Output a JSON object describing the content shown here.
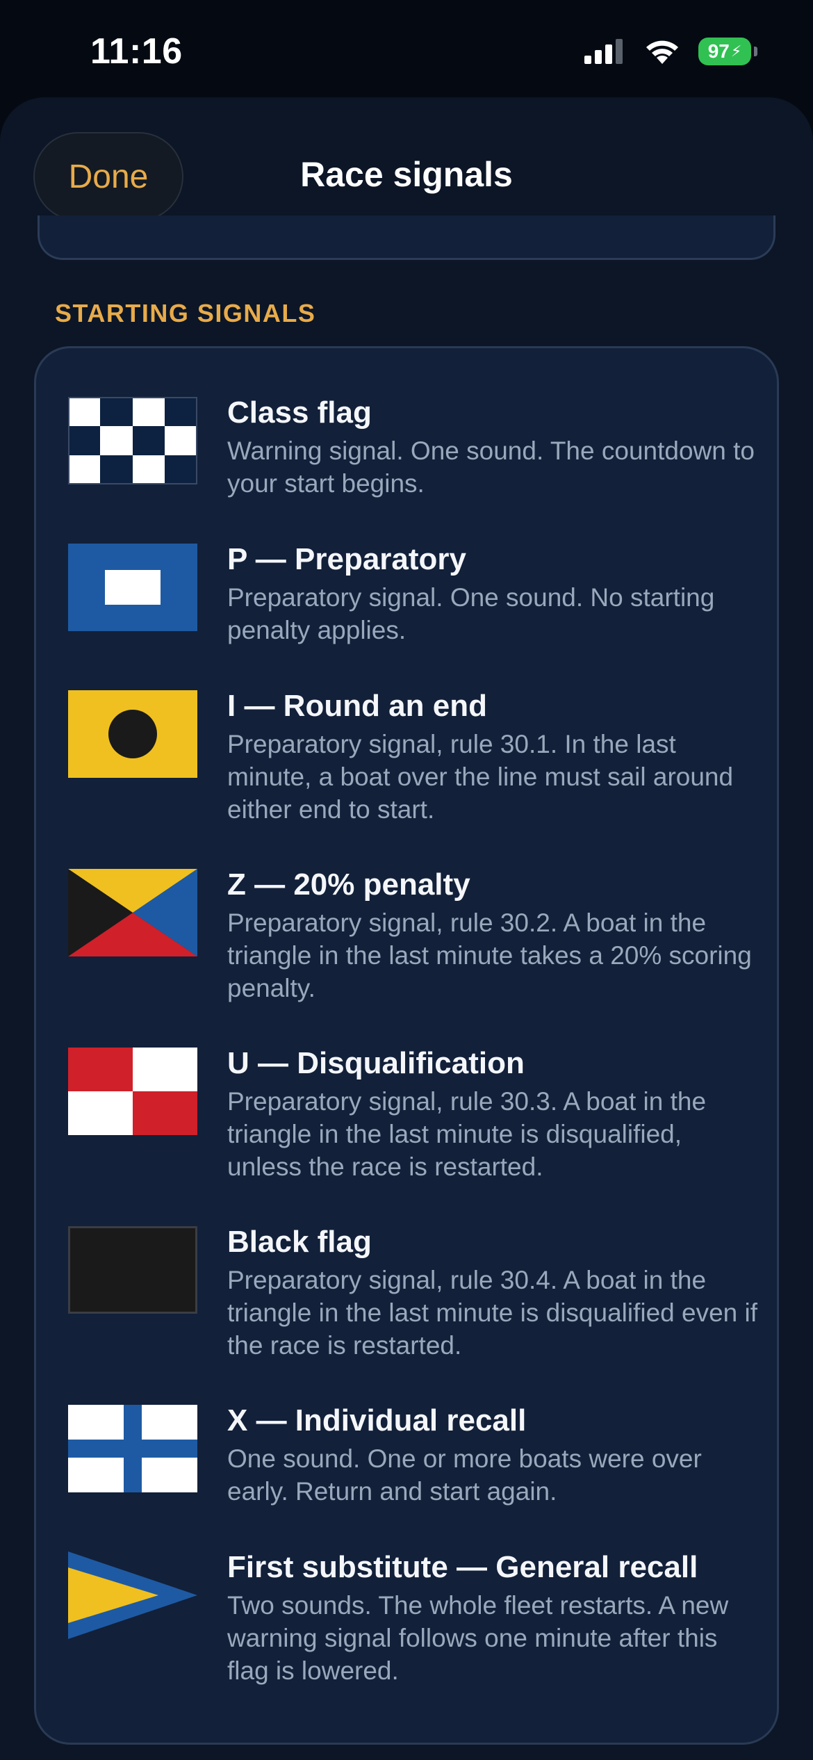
{
  "status_bar": {
    "time": "11:16",
    "battery": "97"
  },
  "header": {
    "done_label": "Done",
    "title": "Race signals"
  },
  "section": {
    "title": "STARTING SIGNALS"
  },
  "signals": [
    {
      "title": "Class flag",
      "description": "Warning signal. One sound. The countdown to your start begins.",
      "flag_icon": "class-flag-icon"
    },
    {
      "title": "P — Preparatory",
      "description": "Preparatory signal. One sound. No starting penalty applies.",
      "flag_icon": "p-flag-icon"
    },
    {
      "title": "I — Round an end",
      "description": "Preparatory signal, rule 30.1. In the last minute, a boat over the line must sail around either end to start.",
      "flag_icon": "i-flag-icon"
    },
    {
      "title": "Z — 20% penalty",
      "description": "Preparatory signal, rule 30.2. A boat in the triangle in the last minute takes a 20% scoring penalty.",
      "flag_icon": "z-flag-icon"
    },
    {
      "title": "U — Disqualification",
      "description": "Preparatory signal, rule 30.3. A boat in the triangle in the last minute is disqualified, unless the race is restarted.",
      "flag_icon": "u-flag-icon"
    },
    {
      "title": "Black flag",
      "description": "Preparatory signal, rule 30.4. A boat in the triangle in the last minute is disqualified even if the race is restarted.",
      "flag_icon": "black-flag-icon"
    },
    {
      "title": "X — Individual recall",
      "description": "One sound. One or more boats were over early. Return and start again.",
      "flag_icon": "x-flag-icon"
    },
    {
      "title": "First substitute — General recall",
      "description": "Two sounds. The whole fleet restarts. A new warning signal follows one minute after this flag is lowered.",
      "flag_icon": "first-substitute-flag-icon"
    }
  ],
  "colors": {
    "accent": "#e8ab4a",
    "flag_blue": "#1e5aa3",
    "flag_yellow": "#f0c020",
    "flag_red": "#d0202a",
    "flag_black": "#1a1a1a",
    "flag_navy": "#0d2240"
  }
}
